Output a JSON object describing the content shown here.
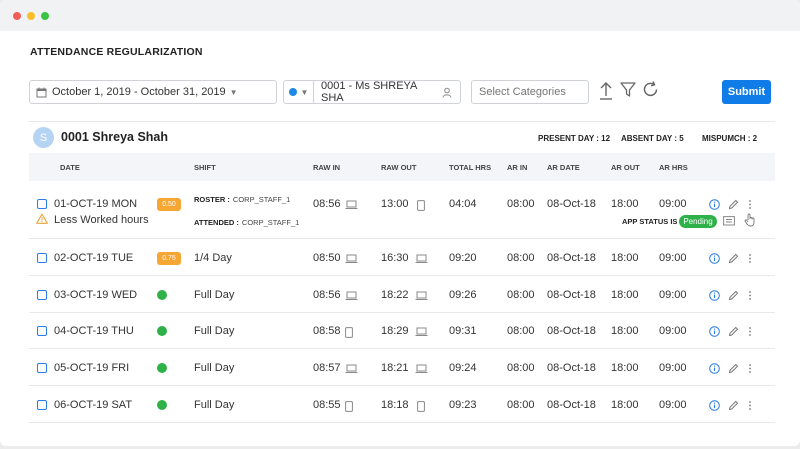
{
  "window": {
    "title": ""
  },
  "page": {
    "title": "ATTENDANCE REGULARIZATION"
  },
  "filters": {
    "date_range": "October 1, 2019 - October 31, 2019",
    "employee": "0001 - Ms SHREYA SHA",
    "categories_placeholder": "Select Categories",
    "submit_label": "Submit"
  },
  "employee": {
    "avatar_initial": "S",
    "name": "0001 Shreya Shah",
    "present_day": "PRESENT DAY : 12",
    "absent_day": "ABSENT DAY : 5",
    "mispunch": "MISPUMCH : 2"
  },
  "columns": [
    "DATE",
    "SHIFT",
    "RAW IN",
    "RAW OUT",
    "TOTAL HRS",
    "AR IN",
    "AR DATE",
    "AR OUT",
    "AR HRS"
  ],
  "first_row_extra": {
    "roster_label": "ROSTER :",
    "roster_value": "CORP_STAFF_1",
    "attended_label": "ATTENDED :",
    "attended_value": "CORP_STAFF_1",
    "warning": "Less Worked hours",
    "app_status_label": "APP STATUS IS",
    "app_status": "Pending"
  },
  "rows": [
    {
      "date": "01-OCT-19 MON",
      "badge": "0.50",
      "shift": "",
      "raw_in": "08:56",
      "raw_in_device": "laptop-icon",
      "raw_out": "13:00",
      "raw_out_device": "mobile-icon",
      "total": "04:04",
      "ar_in": "08:00",
      "ar_date": "08-Oct-18",
      "ar_out": "18:00",
      "ar_hrs": "09:00"
    },
    {
      "date": "02-OCT-19 TUE",
      "badge": "0.75",
      "shift": "1/4 Day",
      "raw_in": "08:50",
      "raw_in_device": "laptop-icon",
      "raw_out": "16:30",
      "raw_out_device": "laptop-icon",
      "total": "09:20",
      "ar_in": "08:00",
      "ar_date": "08-Oct-18",
      "ar_out": "18:00",
      "ar_hrs": "09:00"
    },
    {
      "date": "03-OCT-19 WED",
      "badge": "",
      "shift": "Full Day",
      "raw_in": "08:56",
      "raw_in_device": "laptop-icon",
      "raw_out": "18:22",
      "raw_out_device": "laptop-icon",
      "total": "09:26",
      "ar_in": "08:00",
      "ar_date": "08-Oct-18",
      "ar_out": "18:00",
      "ar_hrs": "09:00"
    },
    {
      "date": "04-OCT-19 THU",
      "badge": "",
      "shift": "Full Day",
      "raw_in": "08:58",
      "raw_in_device": "mobile-icon",
      "raw_out": "18:29",
      "raw_out_device": "laptop-icon",
      "total": "09:31",
      "ar_in": "08:00",
      "ar_date": "08-Oct-18",
      "ar_out": "18:00",
      "ar_hrs": "09:00"
    },
    {
      "date": "05-OCT-19 FRI",
      "badge": "",
      "shift": "Full Day",
      "raw_in": "08:57",
      "raw_in_device": "laptop-icon",
      "raw_out": "18:21",
      "raw_out_device": "laptop-icon",
      "total": "09:24",
      "ar_in": "08:00",
      "ar_date": "08-Oct-18",
      "ar_out": "18:00",
      "ar_hrs": "09:00"
    },
    {
      "date": "06-OCT-19 SAT",
      "badge": "",
      "shift": "Full Day",
      "raw_in": "08:55",
      "raw_in_device": "mobile-icon",
      "raw_out": "18:18",
      "raw_out_device": "mobile-icon",
      "total": "09:23",
      "ar_in": "08:00",
      "ar_date": "08-Oct-18",
      "ar_out": "18:00",
      "ar_hrs": "09:00"
    }
  ],
  "colors": {
    "accent": "#0f7ce8",
    "present": "#2fb14a",
    "half_day": "#f6a632",
    "warning": "#e8a53a"
  }
}
